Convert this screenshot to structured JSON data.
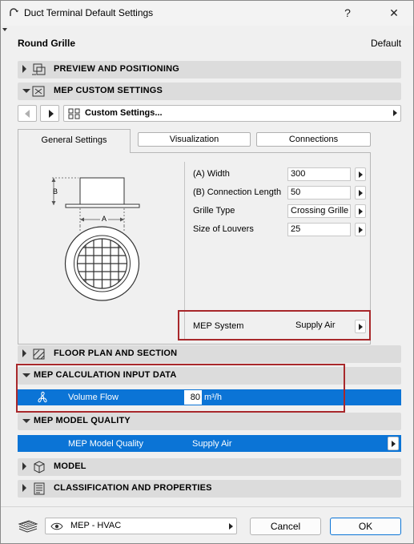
{
  "window": {
    "title": "Duct Terminal Default Settings",
    "help_label": "?",
    "close_label": "✕"
  },
  "header": {
    "left": "Round Grille",
    "right": "Default"
  },
  "sections": {
    "preview": "PREVIEW AND POSITIONING",
    "custom": "MEP CUSTOM SETTINGS",
    "floorplan": "FLOOR PLAN AND SECTION",
    "calc": "MEP CALCULATION INPUT DATA",
    "quality": "MEP MODEL QUALITY",
    "model": "MODEL",
    "classification": "CLASSIFICATION AND PROPERTIES"
  },
  "custom_nav": {
    "label": "Custom Settings..."
  },
  "tabs": [
    "General Settings",
    "Visualization",
    "Connections"
  ],
  "diagram": {
    "label_b": "B",
    "label_a": "A"
  },
  "params": [
    {
      "label": "(A) Width",
      "value": "300"
    },
    {
      "label": "(B) Connection Length",
      "value": "50"
    },
    {
      "label": "Grille Type",
      "value": "Crossing Grille"
    },
    {
      "label": "Size of Louvers",
      "value": "25"
    }
  ],
  "mep_system": {
    "label": "MEP System",
    "value": "Supply Air"
  },
  "calc_row": {
    "label": "Volume Flow",
    "value": "80",
    "unit": "m³/h"
  },
  "quality_row": {
    "label": "MEP Model Quality",
    "value": "Supply Air"
  },
  "footer": {
    "layer": "MEP - HVAC",
    "cancel": "Cancel",
    "ok": "OK"
  },
  "colors": {
    "accent": "#0b74d6",
    "highlight_box": "#a8282b",
    "section_bg": "#dcdcdc"
  }
}
